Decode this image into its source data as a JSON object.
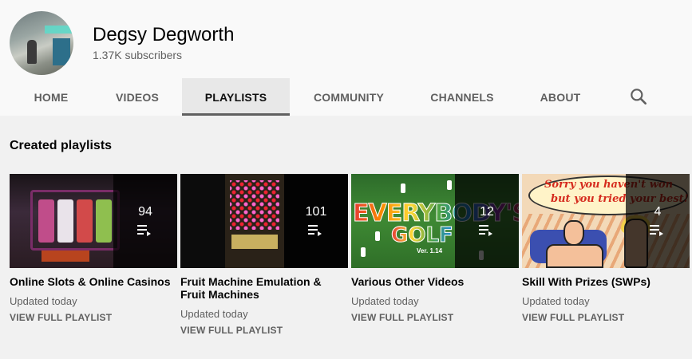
{
  "channel": {
    "name": "Degsy Degworth",
    "subscribers": "1.37K subscribers"
  },
  "tabs": [
    {
      "label": "HOME",
      "active": false
    },
    {
      "label": "VIDEOS",
      "active": false
    },
    {
      "label": "PLAYLISTS",
      "active": true
    },
    {
      "label": "COMMUNITY",
      "active": false
    },
    {
      "label": "CHANNELS",
      "active": false
    },
    {
      "label": "ABOUT",
      "active": false
    }
  ],
  "search_icon": "search-icon",
  "section": {
    "title": "Created playlists"
  },
  "playlists": [
    {
      "title": "Online Slots & Online Casinos",
      "count": "94",
      "updated": "Updated today",
      "link": "VIEW FULL PLAYLIST"
    },
    {
      "title": "Fruit Machine Emulation & Fruit Machines",
      "count": "101",
      "updated": "Updated today",
      "link": "VIEW FULL PLAYLIST"
    },
    {
      "title": "Various Other Videos",
      "count": "12",
      "updated": "Updated today",
      "link": "VIEW FULL PLAYLIST"
    },
    {
      "title": "Skill With Prizes (SWPs)",
      "count": "4",
      "updated": "Updated today",
      "link": "VIEW FULL PLAYLIST"
    }
  ],
  "thumbnail_text": {
    "golf_line1": "EVERYBODY'S",
    "golf_line2": "GOLF",
    "golf_version": "Ver. 1.14",
    "swp_line1": "Sorry you haven't won",
    "swp_line2": "but you tried your best!"
  },
  "colors": {
    "header_bg": "#f9f9f9",
    "page_bg": "#f1f1f1",
    "active_tab_bg": "#e8e8e8",
    "secondary_text": "#606060"
  }
}
